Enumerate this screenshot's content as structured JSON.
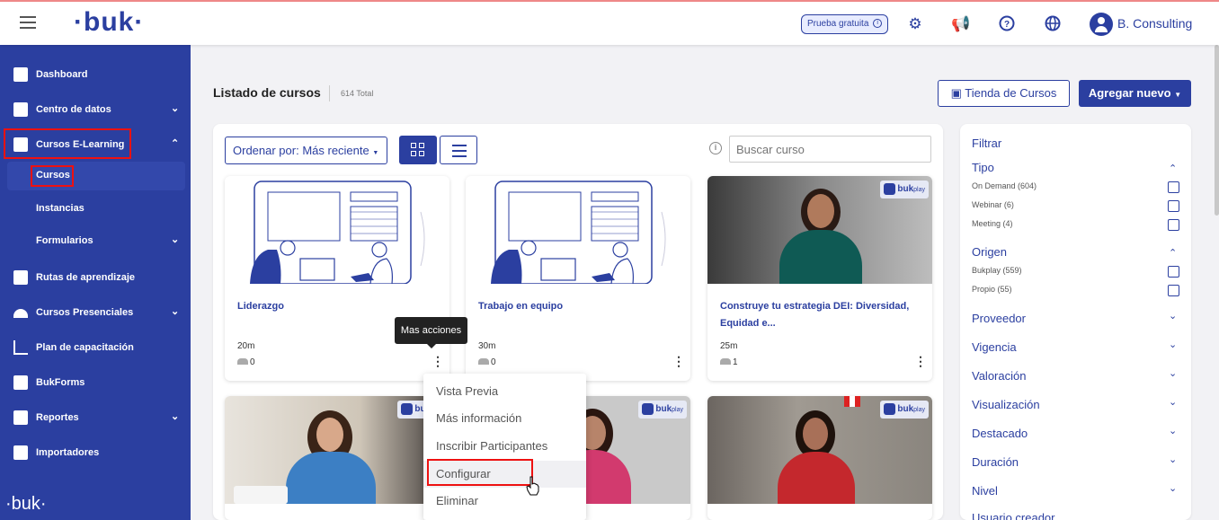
{
  "topbar": {
    "logo": "·buk·",
    "trial_label": "Prueba gratuita",
    "trial_info": "i",
    "icons": [
      "gear-icon",
      "megaphone-icon",
      "help-icon",
      "globe-icon"
    ],
    "user_name": "B. Consulting"
  },
  "sidebar": {
    "items": [
      {
        "label": "Dashboard"
      },
      {
        "label": "Centro de datos"
      },
      {
        "label": "Cursos E-Learning"
      },
      {
        "label": "Rutas de aprendizaje"
      },
      {
        "label": "Cursos Presenciales"
      },
      {
        "label": "Plan de capacitación"
      },
      {
        "label": "BukForms"
      },
      {
        "label": "Reportes"
      },
      {
        "label": "Importadores"
      }
    ],
    "sub_items": [
      {
        "label": "Cursos"
      },
      {
        "label": "Instancias"
      },
      {
        "label": "Formularios"
      }
    ],
    "footer_logo": "·buk·"
  },
  "main": {
    "title": "Listado de cursos",
    "total": "614 Total",
    "store_button": "Tienda de Cursos",
    "add_button": "Agregar nuevo",
    "sort_label": "Ordenar por: Más reciente",
    "search_placeholder": "Buscar curso",
    "tooltip": "Mas acciones",
    "cards": [
      {
        "title": "Liderazgo",
        "duration": "20m",
        "participants": "0"
      },
      {
        "title": "Trabajo en equipo",
        "duration": "30m",
        "participants": "0"
      },
      {
        "title": "Construye tu estrategia DEI: Diversidad, Equidad e...",
        "duration": "25m",
        "participants": "1",
        "badge": "buk",
        "badge_sub": "play"
      },
      {
        "badge": "buk",
        "badge_sub": "play"
      },
      {
        "badge": "buk",
        "badge_sub": "play"
      },
      {
        "badge": "buk",
        "badge_sub": "play"
      }
    ],
    "menu": [
      {
        "label": "Vista Previa"
      },
      {
        "label": "Más información"
      },
      {
        "label": "Inscribir Participantes"
      },
      {
        "label": "Configurar"
      },
      {
        "label": "Eliminar"
      }
    ]
  },
  "filter": {
    "title": "Filtrar",
    "tipo": {
      "label": "Tipo",
      "options": [
        "On Demand (604)",
        "Webinar (6)",
        "Meeting (4)"
      ]
    },
    "origen": {
      "label": "Origen",
      "options": [
        "Bukplay (559)",
        "Propio (55)"
      ]
    },
    "collapsed": [
      "Proveedor",
      "Vigencia",
      "Valoración",
      "Visualización",
      "Destacado",
      "Duración",
      "Nivel",
      "Usuario creador"
    ]
  },
  "colors": {
    "brand": "#2b3fa0",
    "highlight": "#e11111"
  }
}
